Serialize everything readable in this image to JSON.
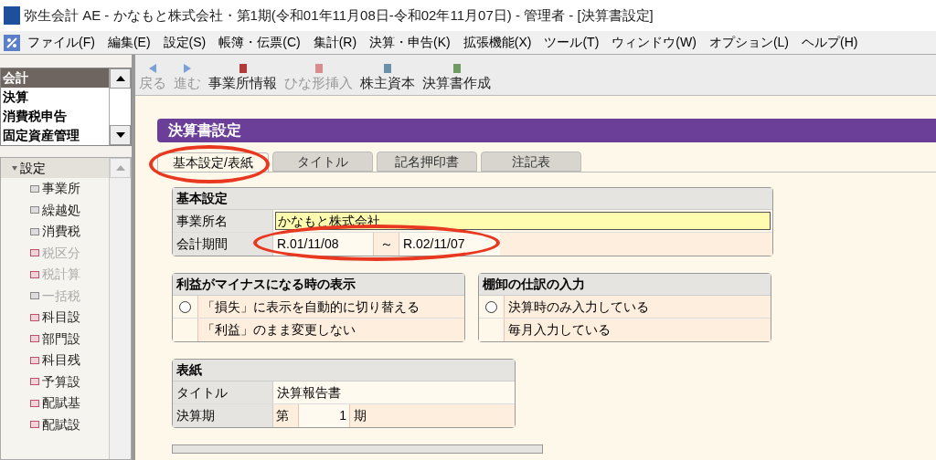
{
  "window": {
    "title": "弥生会計 AE - かなもと株式会社・第1期(令和01年11月08日-令和02年11月07日) - 管理者 - [決算書設定]"
  },
  "menu": [
    "ファイル(F)",
    "編集(E)",
    "設定(S)",
    "帳簿・伝票(C)",
    "集計(R)",
    "決算・申告(K)",
    "拡張機能(X)",
    "ツール(T)",
    "ウィンドウ(W)",
    "オプション(L)",
    "ヘルプ(H)"
  ],
  "category_list": [
    {
      "label": "会計",
      "selected": true
    },
    {
      "label": "決算",
      "selected": false
    },
    {
      "label": "消費税申告",
      "selected": false
    },
    {
      "label": "固定資産管理",
      "selected": false
    }
  ],
  "tree": {
    "label": "設定",
    "expanded": true,
    "children": [
      {
        "label": "事業所",
        "kind": "form",
        "disabled": false
      },
      {
        "label": "繰越処",
        "kind": "form",
        "disabled": false
      },
      {
        "label": "消費税",
        "kind": "form",
        "disabled": false
      },
      {
        "label": "税区分",
        "kind": "book",
        "disabled": true
      },
      {
        "label": "税計算",
        "kind": "book",
        "disabled": true
      },
      {
        "label": "一括税",
        "kind": "form",
        "disabled": true
      },
      {
        "label": "科目設",
        "kind": "book",
        "disabled": false
      },
      {
        "label": "部門設",
        "kind": "book",
        "disabled": false
      },
      {
        "label": "科目残",
        "kind": "book",
        "disabled": false
      },
      {
        "label": "予算設",
        "kind": "book",
        "disabled": false
      },
      {
        "label": "配賦基",
        "kind": "book",
        "disabled": false
      },
      {
        "label": "配賦設",
        "kind": "book",
        "disabled": false
      }
    ]
  },
  "toolbar": [
    {
      "label": "戻る",
      "kind": "back",
      "disabled": true
    },
    {
      "label": "進む",
      "kind": "forward",
      "disabled": true
    },
    {
      "label": "事業所情報",
      "kind": "office",
      "disabled": false
    },
    {
      "label": "ひな形挿入",
      "kind": "template",
      "disabled": true
    },
    {
      "label": "株主資本",
      "kind": "equity",
      "disabled": false
    },
    {
      "label": "決算書作成",
      "kind": "report",
      "disabled": false
    }
  ],
  "panel_title": "決算書設定",
  "tabs": [
    {
      "label": "基本設定/表紙",
      "selected": true
    },
    {
      "label": "タイトル",
      "selected": false
    },
    {
      "label": "記名押印書",
      "selected": false
    },
    {
      "label": "注記表",
      "selected": false
    }
  ],
  "basic": {
    "title": "基本設定",
    "office_label": "事業所名",
    "office_value": "かなもと株式会社",
    "period_label": "会計期間",
    "period_from": "R.01/11/08",
    "period_sep": "～",
    "period_to": "R.02/11/07"
  },
  "loss_display": {
    "title": "利益がマイナスになる時の表示",
    "options": [
      {
        "label": "「損失」に表示を自動的に切り替える",
        "kind": "radio",
        "selected": false
      },
      {
        "label": "「利益」のまま変更しない",
        "kind": "plain"
      }
    ]
  },
  "inventory": {
    "title": "棚卸の仕訳の入力",
    "options": [
      {
        "label": "決算時のみ入力している",
        "kind": "radio",
        "selected": false
      },
      {
        "label": "毎月入力している",
        "kind": "plain"
      }
    ]
  },
  "cover": {
    "title": "表紙",
    "title_label": "タイトル",
    "title_value": "決算報告書",
    "term_label": "決算期",
    "term_prefix": "第",
    "term_value": "1",
    "term_suffix": "期"
  }
}
